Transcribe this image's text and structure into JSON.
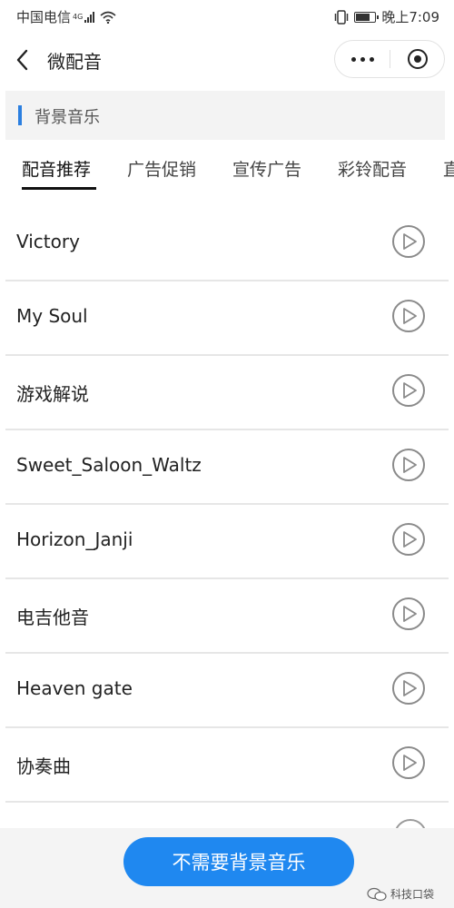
{
  "status_bar": {
    "carrier": "中国电信",
    "network": "4G",
    "time": "晚上7:09",
    "battery_level": 0.8
  },
  "nav": {
    "title": "微配音",
    "back_icon": "chevron-left-icon",
    "more_icon": "more-dots-icon",
    "close_icon": "target-icon"
  },
  "section": {
    "title": "背景音乐",
    "accent_color": "#2b7fe0"
  },
  "tabs": [
    {
      "label": "配音推荐",
      "active": true
    },
    {
      "label": "广告促销",
      "active": false
    },
    {
      "label": "宣传广告",
      "active": false
    },
    {
      "label": "彩铃配音",
      "active": false
    },
    {
      "label": "直",
      "active": false
    }
  ],
  "tracks": [
    {
      "name": "Victory"
    },
    {
      "name": "My Soul"
    },
    {
      "name": "游戏解说"
    },
    {
      "name": "Sweet_Saloon_Waltz"
    },
    {
      "name": "Horizon_Janji"
    },
    {
      "name": "电吉他音"
    },
    {
      "name": "Heaven gate"
    },
    {
      "name": "协奏曲"
    }
  ],
  "bottom": {
    "button_label": "不需要背景音乐",
    "button_color": "#1f88f0"
  },
  "watermark": {
    "text": "科技口袋"
  }
}
